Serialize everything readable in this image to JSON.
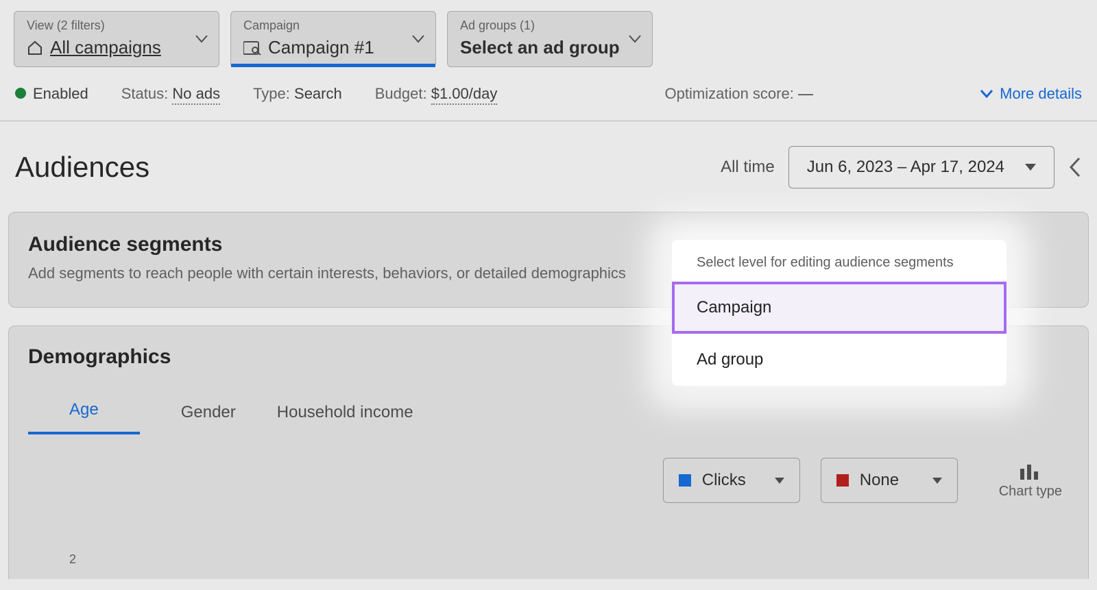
{
  "crumbs": {
    "view": {
      "label": "View (2 filters)",
      "value": "All campaigns"
    },
    "camp": {
      "label": "Campaign",
      "value": "Campaign #1"
    },
    "adgrp": {
      "label": "Ad groups (1)",
      "value": "Select an ad group"
    }
  },
  "status": {
    "enabled": "Enabled",
    "status_lbl": "Status:",
    "status_val": "No ads",
    "type_lbl": "Type:",
    "type_val": "Search",
    "budget_lbl": "Budget:",
    "budget_val": "$1.00/day",
    "opt_lbl": "Optimization score:",
    "opt_val": "—",
    "more": "More details"
  },
  "page": {
    "title": "Audiences",
    "range_label": "All time",
    "range_value": "Jun 6, 2023 – Apr 17, 2024"
  },
  "segments_card": {
    "title": "Audience segments",
    "sub": "Add segments to reach people with certain interests, behaviors, or detailed demographics"
  },
  "demo": {
    "title": "Demographics",
    "tabs": {
      "age": "Age",
      "gender": "Gender",
      "income": "Household income"
    },
    "metric1": "Clicks",
    "metric2": "None",
    "chart_type": "Chart type",
    "axis_tick": "2"
  },
  "popup": {
    "header": "Select level for editing audience segments",
    "opt1": "Campaign",
    "opt2": "Ad group"
  }
}
